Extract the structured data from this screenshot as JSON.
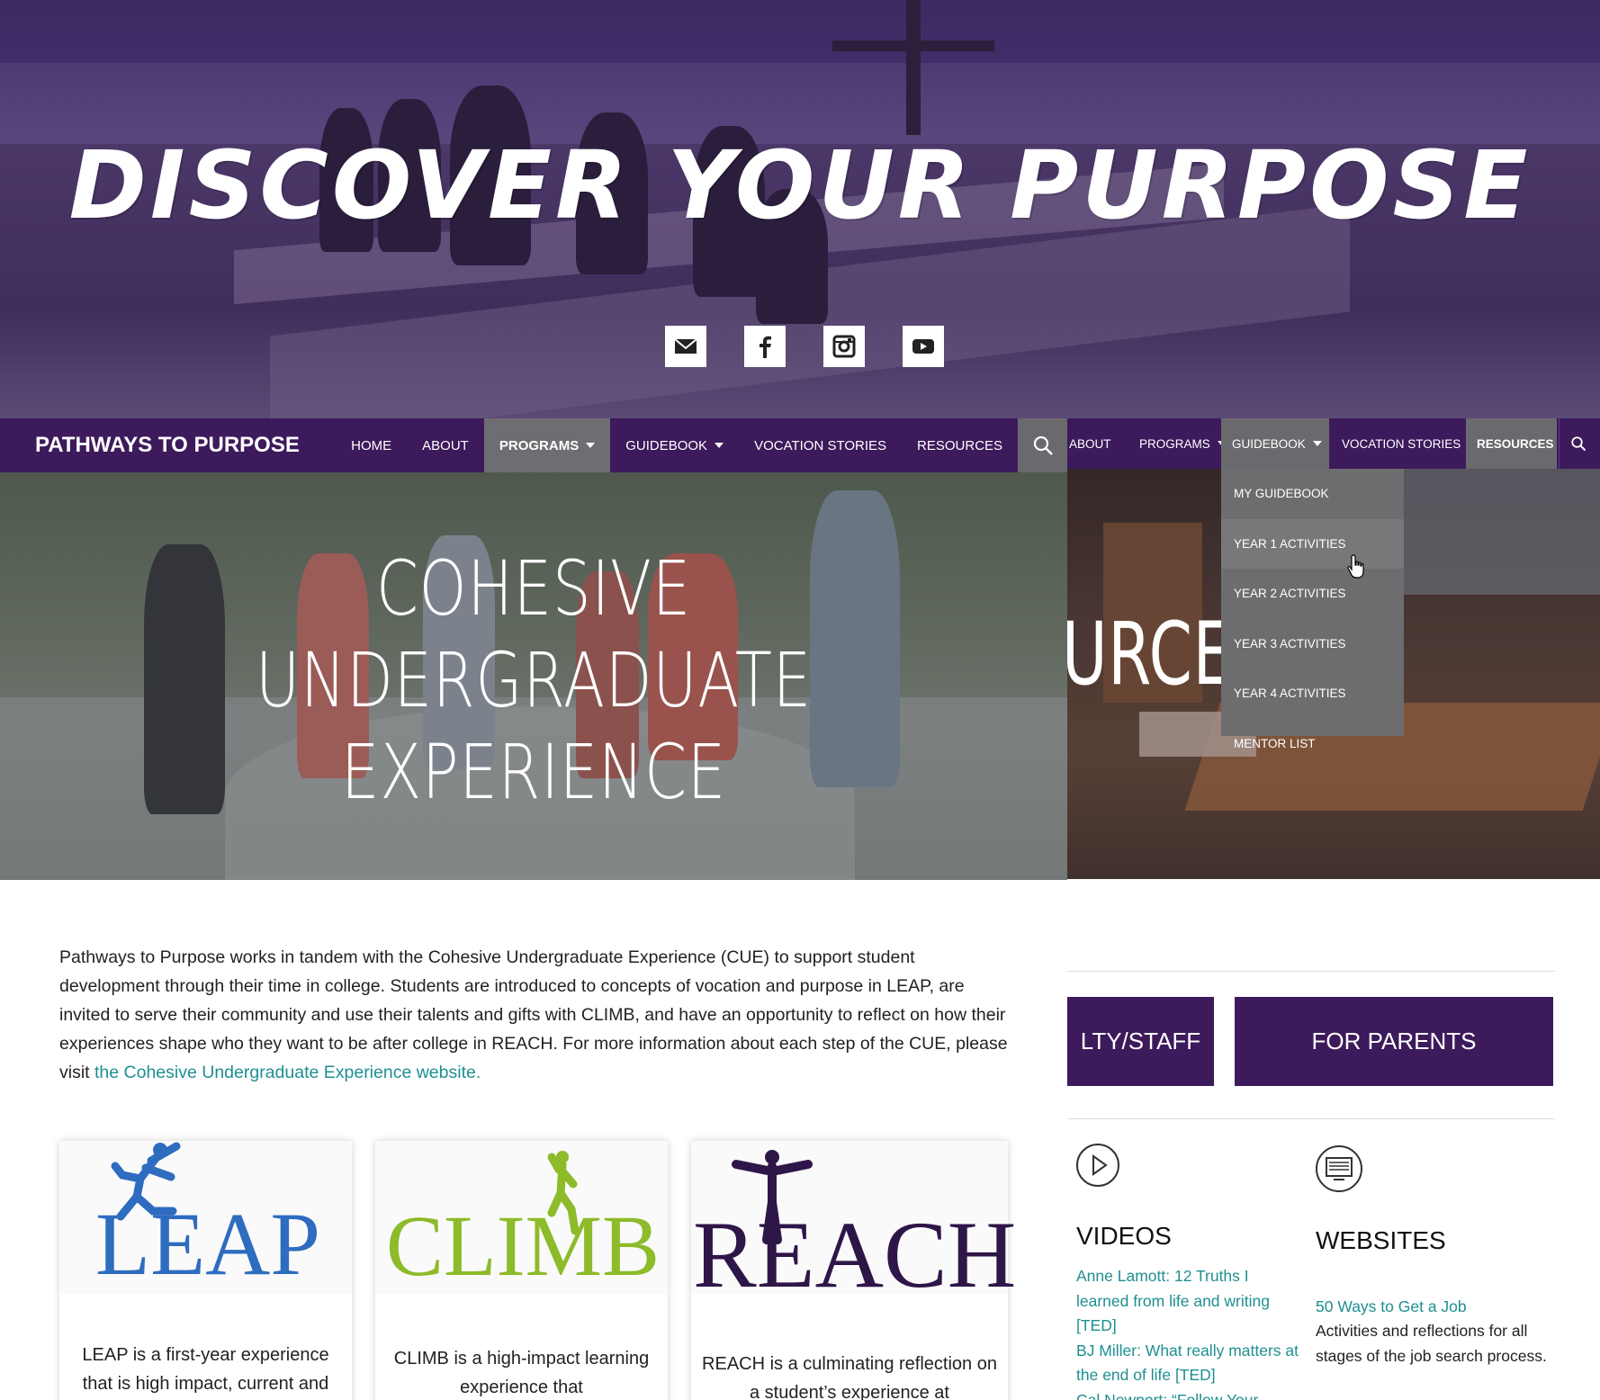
{
  "hero": {
    "title": "DISCOVER YOUR PURPOSE",
    "social_icons": [
      "email-icon",
      "facebook-icon",
      "instagram-icon",
      "youtube-icon"
    ]
  },
  "nav": {
    "brand": "PATHWAYS TO PURPOSE",
    "items": [
      {
        "label": "HOME"
      },
      {
        "label": "ABOUT"
      },
      {
        "label": "PROGRAMS",
        "active": true
      },
      {
        "label": "GUIDEBOOK"
      },
      {
        "label": "VOCATION STORIES"
      },
      {
        "label": "RESOURCES"
      }
    ]
  },
  "banner": {
    "line1": "COHESIVE",
    "line2": "UNDERGRADUATE",
    "line3": "EXPERIENCE"
  },
  "intro": {
    "text": "Pathways to Purpose works in tandem with the Cohesive Undergraduate Experience (CUE) to support student development through their time in college. Students are introduced to concepts of vocation and purpose in LEAP, are invited to serve their community and use their talents and gifts with CLIMB, and have an opportunity to reflect on how their experiences shape who they want to be after college in REACH. For more information about each step of the CUE, please visit ",
    "link": "the Cohesive Undergraduate Experience website."
  },
  "cards": [
    {
      "logo": "LEAP",
      "color": "#2e6cc0",
      "desc": "LEAP is a first-year experience that is high impact, current and"
    },
    {
      "logo": "CLIMB",
      "color": "#8dbb2a",
      "desc": "CLIMB is a high-impact learning experience that"
    },
    {
      "logo": "REACH",
      "color": "#2f1648",
      "desc": "REACH is a culminating reflection on a student’s experience at"
    }
  ],
  "right_nav": {
    "items": [
      "ABOUT",
      "PROGRAMS",
      "GUIDEBOOK",
      "VOCATION STORIES",
      "RESOURCES"
    ]
  },
  "right_banner": {
    "text": "URCE"
  },
  "dropdown": {
    "items": [
      "MY GUIDEBOOK",
      "YEAR 1 ACTIVITIES",
      "YEAR 2 ACTIVITIES",
      "YEAR 3 ACTIVITIES",
      "YEAR 4 ACTIVITIES",
      "MENTOR LIST"
    ]
  },
  "buttons": {
    "faculty": "LTY/STAFF",
    "parents": "FOR PARENTS"
  },
  "resources": {
    "videos": {
      "heading": "VIDEOS",
      "links": [
        "Anne Lamott: 12 Truths I learned from life and writing [TED]",
        "BJ Miller: What really matters at the end of life [TED]",
        "Cal Newport: “Follow Your"
      ]
    },
    "websites": {
      "heading": "WEBSITES",
      "link": "50 Ways to Get a Job",
      "text": "Activities and reflections for all stages of the job search process."
    }
  }
}
